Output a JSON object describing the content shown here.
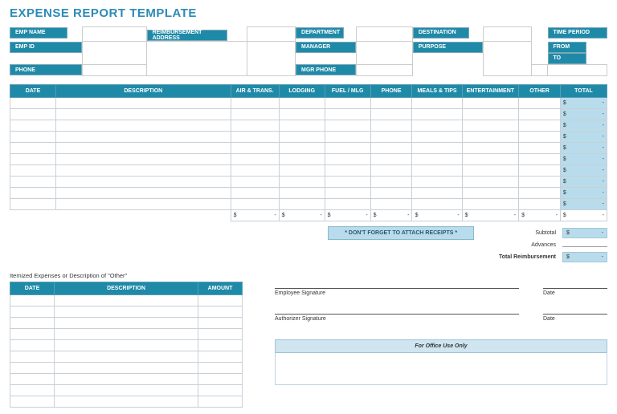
{
  "title": "EXPENSE REPORT TEMPLATE",
  "header": {
    "emp_name": "EMP NAME",
    "emp_id": "EMP ID",
    "phone": "PHONE",
    "reimbursement_address": "REIMBURSEMENT ADDRESS",
    "department": "DEPARTMENT",
    "manager": "MANAGER",
    "mgr_phone": "MGR PHONE",
    "destination": "DESTINATION",
    "purpose": "PURPOSE",
    "time_period": "TIME PERIOD",
    "from": "FROM",
    "to": "TO"
  },
  "columns": {
    "date": "DATE",
    "description": "DESCRIPTION",
    "air_trans": "AIR & TRANS.",
    "lodging": "LODGING",
    "fuel_mlg": "FUEL / MLG",
    "phone": "PHONE",
    "meals_tips": "MEALS & TIPS",
    "entertainment": "ENTERTAINMENT",
    "other": "OTHER",
    "total": "TOTAL"
  },
  "currency": "$",
  "dash": "-",
  "reminder": "* DON'T FORGET TO ATTACH RECEIPTS *",
  "summary": {
    "subtotal": "Subtotal",
    "advances": "Advances",
    "total_reimbursement": "Total Reimbursement"
  },
  "other_section": {
    "caption": "Itemized Expenses or Description of \"Other\"",
    "date": "DATE",
    "description": "DESCRIPTION",
    "amount": "AMOUNT"
  },
  "signatures": {
    "employee": "Employee Signature",
    "authorizer": "Authorizer Signature",
    "date": "Date"
  },
  "office": "For Office Use Only"
}
